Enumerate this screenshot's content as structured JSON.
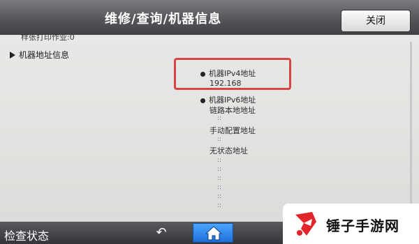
{
  "header": {
    "title": "维修/查询/机器信息",
    "close_label": "关闭"
  },
  "content": {
    "truncated_line": "样张打印作业:0",
    "section_label": "机器地址信息",
    "ipv4": {
      "label": "机器IPv4地址",
      "value": "192.168"
    },
    "ipv6": {
      "label": "机器IPv6地址",
      "link_local_label": "链路本地地址",
      "manual_label": "手动配置地址",
      "stateless_label": "无状态地址",
      "placeholder": "::"
    }
  },
  "footer": {
    "status_label": "检查状态",
    "back_icon": "back-arrow-icon",
    "home_icon": "home-icon"
  },
  "watermark": {
    "text": "锤子手游网"
  },
  "colors": {
    "highlight_border": "#d94545",
    "home_button": "#2f86ee"
  }
}
